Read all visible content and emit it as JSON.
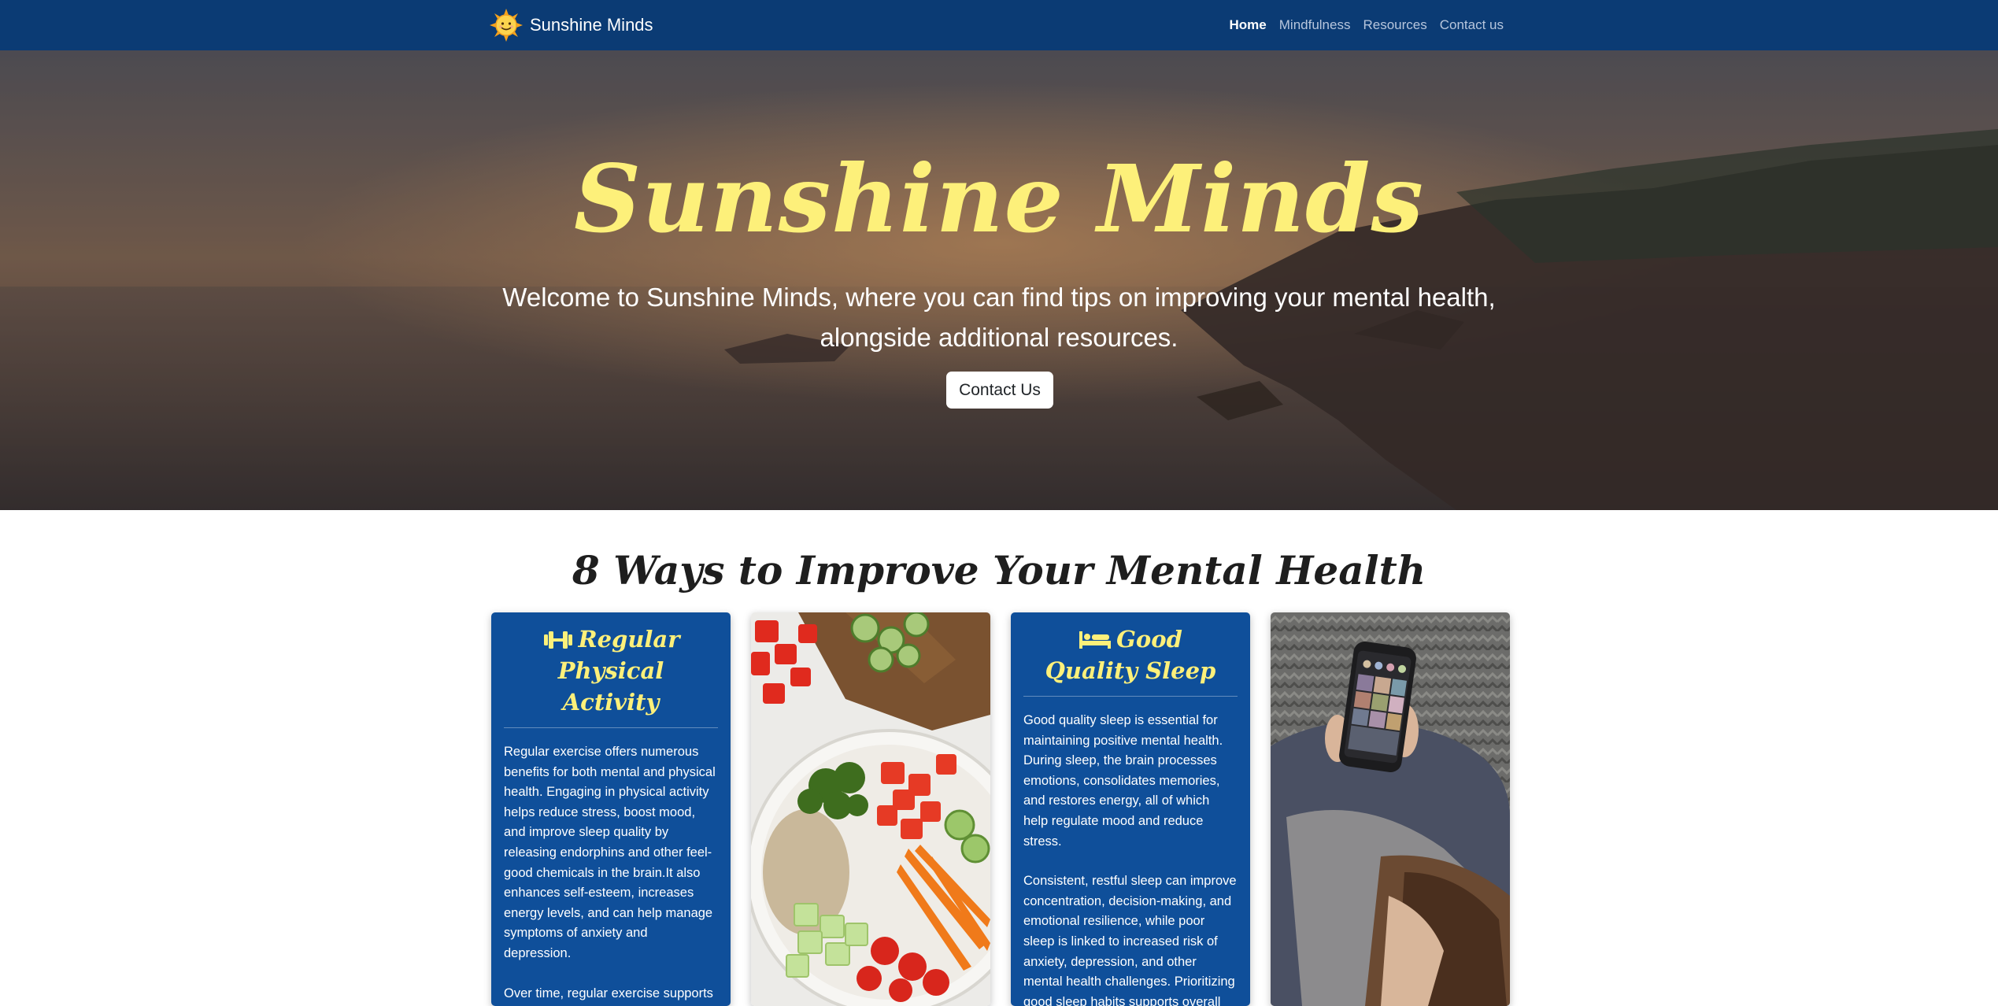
{
  "nav": {
    "brand": "Sunshine Minds",
    "brand_logo_icon": "smiling-sun-icon",
    "links": [
      "Home",
      "Mindfulness",
      "Resources",
      "Contact us"
    ],
    "active_link": "Home"
  },
  "hero": {
    "title": "Sunshine Minds",
    "subtitle": "Welcome to Sunshine Minds, where you can find tips on improving your mental health, alongside additional resources.",
    "button": "Contact Us"
  },
  "section": {
    "title": "8 Ways to Improve Your Mental Health",
    "cards": [
      {
        "icon": "dumbbell-icon",
        "heading": "Regular Physical Activity",
        "paragraphs": [
          "Regular exercise offers numerous benefits for both mental and physical health. Engaging in physical activity helps reduce stress, boost mood, and improve sleep quality by releasing endorphins and other feel-good chemicals in the brain.It also enhances self-esteem, increases energy levels, and can help manage symptoms of anxiety and depression.",
          "Over time, regular exercise supports overall wellbeing and resilience,"
        ]
      },
      {
        "image": "healthy-salad-bowl-photo"
      },
      {
        "icon": "bed-icon",
        "heading": "Good Quality Sleep",
        "paragraphs": [
          "Good quality sleep is essential for maintaining positive mental health. During sleep, the brain processes emotions, consolidates memories, and restores energy, all of which help regulate mood and reduce stress.",
          "Consistent, restful sleep can improve concentration, decision-making, and emotional resilience, while poor sleep is linked to increased risk of anxiety, depression, and other mental health challenges. Prioritizing good sleep habits supports overall wellbeing and helps"
        ]
      },
      {
        "image": "person-using-smartphone-photo"
      }
    ]
  },
  "colors": {
    "navbar": "#0b3b74",
    "card": "#0f4f9a",
    "accent_yellow": "#fdf07a"
  }
}
